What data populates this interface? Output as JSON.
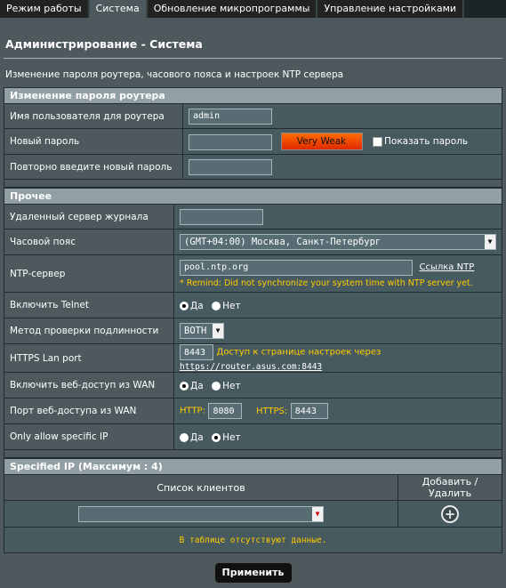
{
  "tabs": [
    "Режим работы",
    "Система",
    "Обновление микропрограммы",
    "Управление настройками"
  ],
  "page": {
    "title": "Администрирование - Система",
    "description": "Изменение пароля роутера, часового пояса и настроек NTP сервера"
  },
  "password_section": {
    "title": "Изменение пароля роутера",
    "username_label": "Имя пользователя для роутера",
    "username_value": "admin",
    "new_password_label": "Новый пароль",
    "new_password_value": "",
    "strength": "Very Weak",
    "show_password_label": "Показать пароль",
    "confirm_label": "Повторно введите новый пароль",
    "confirm_value": ""
  },
  "misc_section": {
    "title": "Прочее",
    "log_server_label": "Удаленный сервер журнала",
    "log_server_value": "",
    "timezone_label": "Часовой пояс",
    "timezone_value": "(GMT+04:00) Москва, Санкт-Петербург",
    "ntp_label": "NTP-сервер",
    "ntp_value": "pool.ntp.org",
    "ntp_link": "Ссылка NTP",
    "ntp_remind": "* Remind: Did not synchronize your system time with NTP server yet.",
    "telnet_label": "Включить Telnet",
    "auth_label": "Метод проверки подлинности",
    "auth_value": "BOTH",
    "https_port_label": "HTTPS Lan port",
    "https_port_value": "8443",
    "https_access_text": "Доступ к странице настроек через",
    "https_access_url": "https://router.asus.com:8443",
    "wan_access_label": "Включить веб-доступ из WAN",
    "wan_port_label": "Порт веб-доступа из WAN",
    "http_label": "HTTP:",
    "http_port": "8080",
    "https_label": "HTTPS:",
    "https_port": "8443",
    "specific_ip_label": "Only allow specific IP",
    "yes": "Да",
    "no": "Нет"
  },
  "specified_ip": {
    "title": "Specified IP (Максимум : 4)",
    "col_clients": "Список клиентов",
    "col_add_delete": "Добавить / Удалить",
    "no_data": "В таблице отсутствуют данные."
  },
  "apply_button": "Применить"
}
